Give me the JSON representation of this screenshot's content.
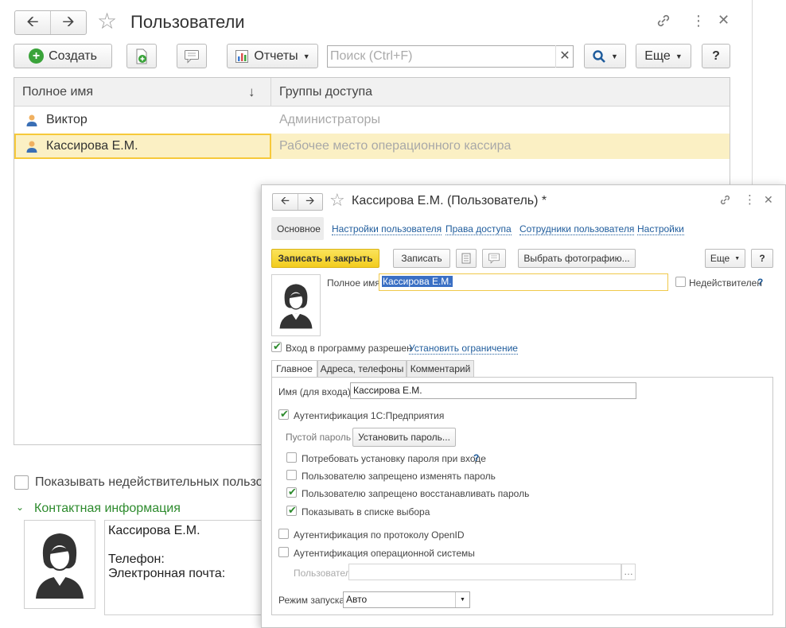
{
  "main": {
    "title": "Пользователи",
    "toolbar": {
      "create_label": "Создать",
      "reports_label": "Отчеты",
      "search_placeholder": "Поиск (Ctrl+F)",
      "more_label": "Еще",
      "help_label": "?"
    },
    "table": {
      "columns": [
        "Полное имя",
        "Группы доступа"
      ],
      "sort_indicator": "↓",
      "rows": [
        {
          "name": "Виктор",
          "groups": "Администраторы"
        },
        {
          "name": "Кассирова Е.М.",
          "groups": "Рабочее место операционного кассира"
        }
      ]
    },
    "show_inactive_label": "Показывать недействительных пользователей",
    "contact_section_label": "Контактная информация",
    "contact": {
      "name": "Кассирова Е.М.",
      "phone_label": "Телефон:",
      "email_label": "Электронная почта:"
    }
  },
  "dialog": {
    "title": "Кассирова Е.М. (Пользователь) *",
    "tabs": [
      "Основное",
      "Настройки пользователя",
      "Права доступа",
      "Сотрудники пользователя",
      "Настройки"
    ],
    "toolbar": {
      "save_close": "Записать и закрыть",
      "save": "Записать",
      "choose_photo": "Выбрать фотографию...",
      "more": "Еще",
      "help": "?"
    },
    "full_name_label": "Полное имя:",
    "full_name_value": "Кассирова Е.М.",
    "inactive_label": "Недействителен",
    "login_allowed_label": "Вход в программу разрешен",
    "set_restriction_link": "Установить ограничение",
    "inner_tabs": [
      "Главное",
      "Адреса, телефоны",
      "Комментарий"
    ],
    "login_name_label": "Имя (для входа):",
    "login_name_value": "Кассирова Е.М.",
    "auth_1c_label": "Аутентификация 1С:Предприятия",
    "empty_password_label": "Пустой пароль",
    "set_password_button": "Установить пароль...",
    "require_password_label": "Потребовать установку пароля при входе",
    "forbid_change_label": "Пользователю запрещено изменять пароль",
    "forbid_restore_label": "Пользователю запрещено восстанавливать пароль",
    "show_in_list_label": "Показывать в списке выбора",
    "openid_label": "Аутентификация по протоколу OpenID",
    "os_auth_label": "Аутентификация операционной системы",
    "os_user_label": "Пользователь:",
    "run_mode_label": "Режим запуска:",
    "run_mode_value": "Авто",
    "checks": {
      "login_allowed": true,
      "inactive": false,
      "auth_1c": true,
      "require_password": false,
      "forbid_change": false,
      "forbid_restore": true,
      "show_in_list": true,
      "openid": false,
      "os_auth": false,
      "show_inactive": false
    }
  },
  "colors": {
    "accent_yellow": "#f7d93a",
    "selection_row": "#fbf0c4",
    "link_blue": "#1f5c9c",
    "green": "#2e8b2e"
  }
}
